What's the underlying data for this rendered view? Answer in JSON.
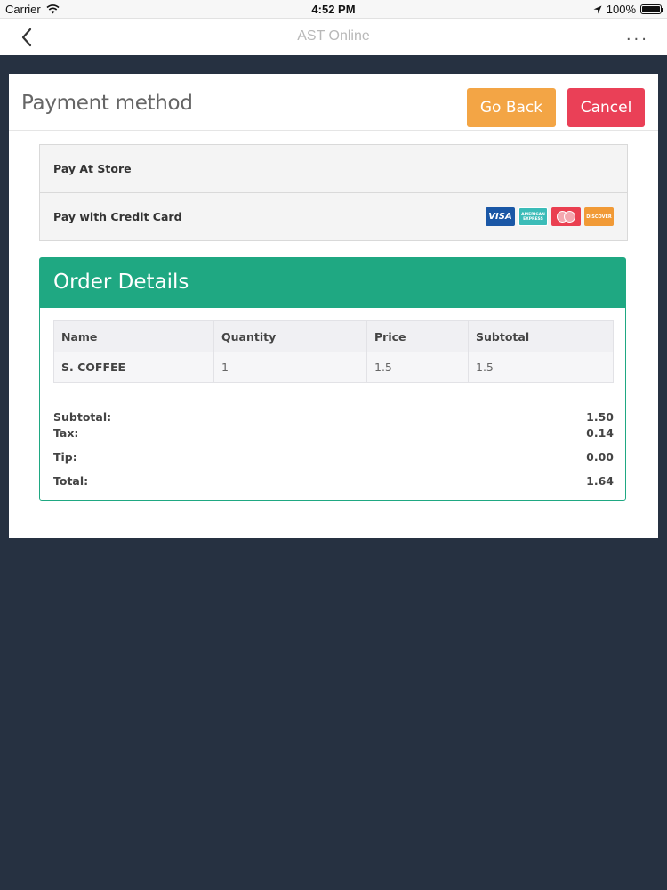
{
  "status_bar": {
    "carrier": "Carrier",
    "time": "4:52 PM",
    "battery": "100%",
    "battery_level": 1.0
  },
  "nav": {
    "title": "AST Online",
    "more": "...",
    "back_icon": "chevron-left-icon"
  },
  "page": {
    "title": "Payment method",
    "go_back_label": "Go Back",
    "cancel_label": "Cancel"
  },
  "colors": {
    "go_back": "#f3a545",
    "cancel": "#ea4057",
    "order_header": "#1fa882",
    "background": "#263141"
  },
  "payment_options": [
    {
      "label": "Pay At Store"
    },
    {
      "label": "Pay with Credit Card",
      "cards": [
        "VISA",
        "AMERICAN EXPRESS",
        "mastercard",
        "DISCOVER"
      ]
    }
  ],
  "order": {
    "title": "Order Details",
    "columns": [
      "Name",
      "Quantity",
      "Price",
      "Subtotal"
    ],
    "rows": [
      {
        "name": "S. COFFEE",
        "quantity": "1",
        "price": "1.5",
        "subtotal": "1.5"
      }
    ],
    "totals": {
      "subtotal_label": "Subtotal:",
      "subtotal": "1.50",
      "tax_label": "Tax:",
      "tax": "0.14",
      "tip_label": "Tip:",
      "tip": "0.00",
      "total_label": "Total:",
      "total": "1.64"
    }
  }
}
